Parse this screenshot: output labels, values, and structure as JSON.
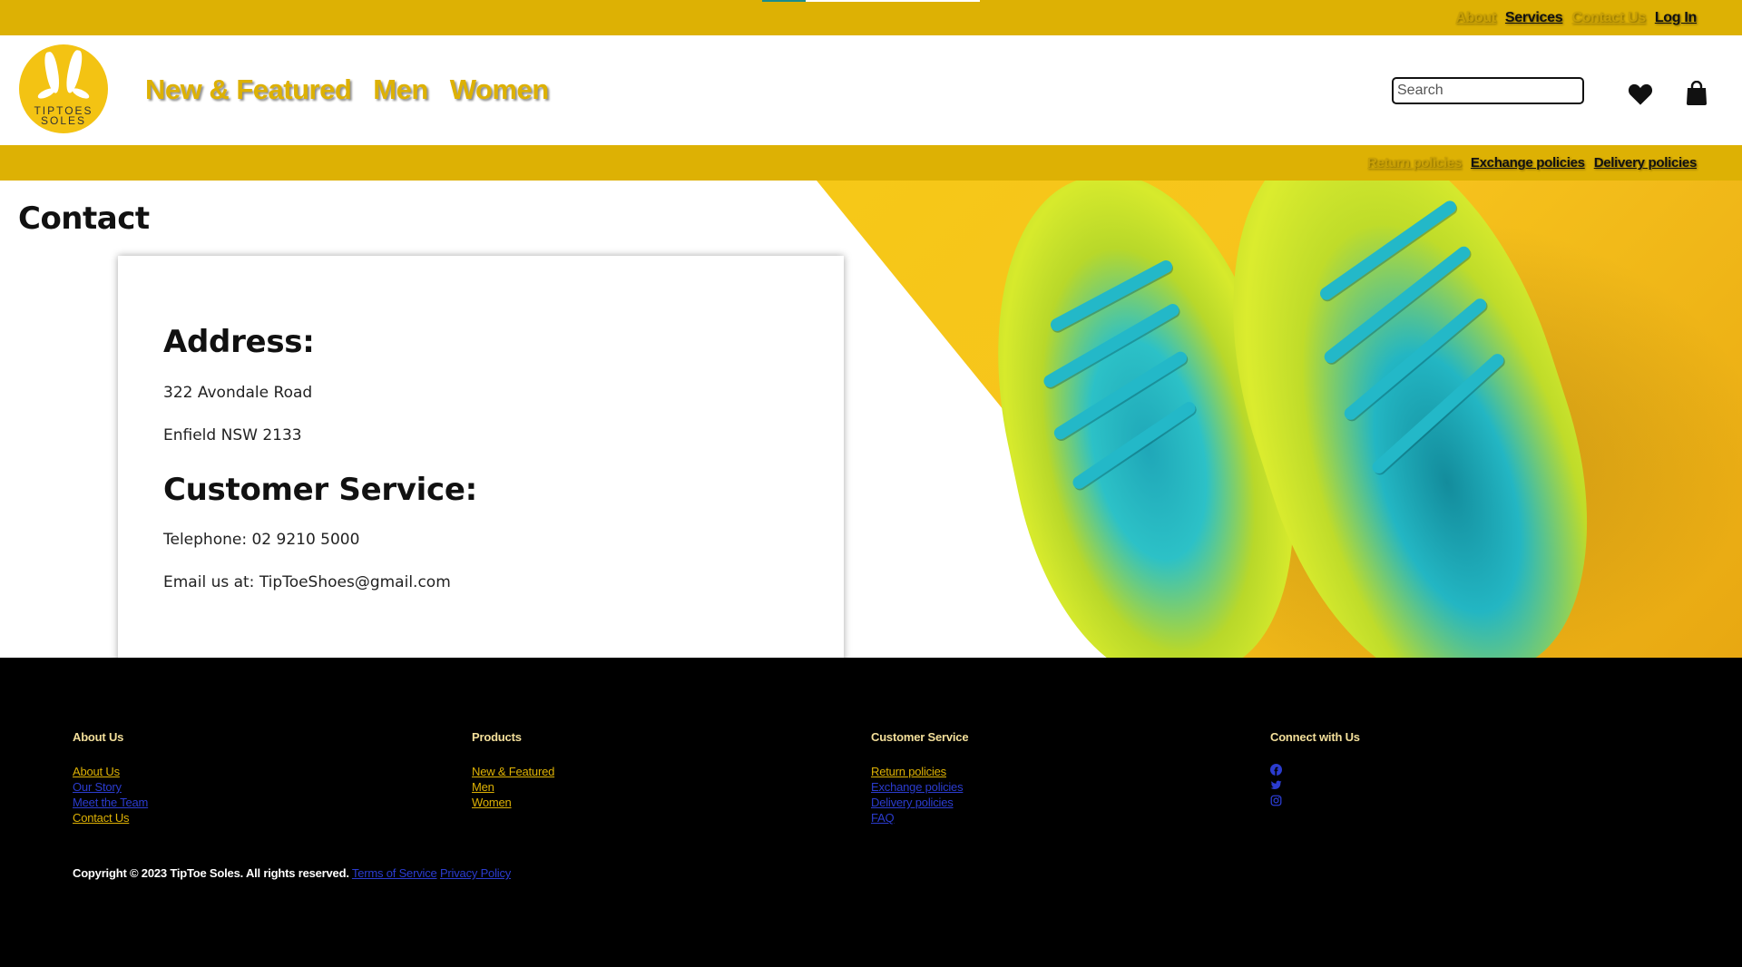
{
  "top_nav": {
    "about": "About",
    "services": "Services",
    "contact": "Contact Us",
    "login": "Log In"
  },
  "header": {
    "logo_line1": "TIPTOES",
    "logo_line2": "SOLES",
    "nav": [
      "New & Featured",
      "Men",
      "Women"
    ],
    "search_placeholder": "Search"
  },
  "policy_nav": {
    "return": "Return policies",
    "exchange": "Exchange policies",
    "delivery": "Delivery policies"
  },
  "main": {
    "title": "Contact",
    "address_heading": "Address:",
    "address_line1": "322 Avondale Road",
    "address_line2": "Enfield NSW 2133",
    "cs_heading": "Customer Service:",
    "telephone": "Telephone: 02 9210 5000",
    "email": "Email us at: TipToeShoes@gmail.com"
  },
  "footer": {
    "about": {
      "heading": "About Us",
      "links": [
        "About Us",
        "Our Story",
        "Meet the Team",
        "Contact Us"
      ]
    },
    "products": {
      "heading": "Products",
      "links": [
        "New & Featured",
        "Men",
        "Women"
      ]
    },
    "service": {
      "heading": "Customer Service",
      "links": [
        "Return policies",
        "Exchange policies",
        "Delivery policies",
        "FAQ"
      ]
    },
    "connect": {
      "heading": "Connect with Us",
      "icons": [
        "facebook-icon",
        "twitter-icon",
        "instagram-icon"
      ]
    },
    "copyright": "Copyright © 2023 TipToe Soles. All rights reserved.",
    "terms": "Terms of Service",
    "privacy": "Privacy Policy"
  },
  "colors": {
    "brand_gold": "#ddb104",
    "footer_bg": "#000000",
    "link_blue": "#2b3ccf"
  }
}
